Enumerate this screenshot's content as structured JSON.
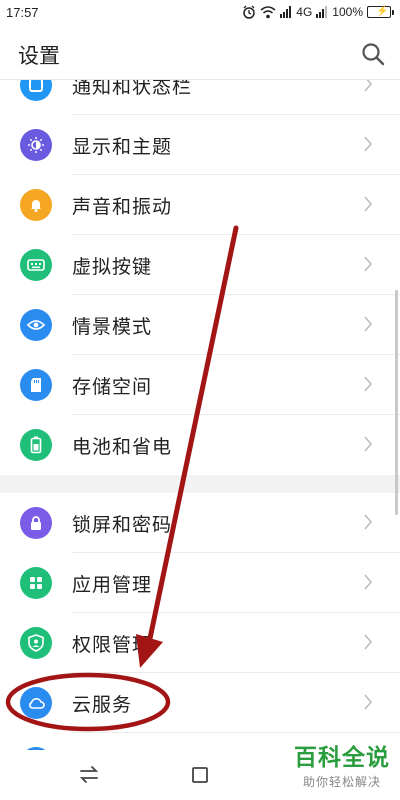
{
  "status_bar": {
    "time": "17:57",
    "network": "4G",
    "battery": "100%"
  },
  "header": {
    "title": "设置",
    "search_icon": "search-icon"
  },
  "settings_items": [
    {
      "label": "通知和状态栏",
      "icon": "notification-icon",
      "color": "#2196f3"
    },
    {
      "label": "显示和主题",
      "icon": "display-icon",
      "color": "#6a5ae0"
    },
    {
      "label": "声音和振动",
      "icon": "bell-icon",
      "color": "#f5a623"
    },
    {
      "label": "虚拟按键",
      "icon": "keyboard-icon",
      "color": "#1fbf7a"
    },
    {
      "label": "情景模式",
      "icon": "eye-icon",
      "color": "#2b8cf0"
    },
    {
      "label": "存储空间",
      "icon": "sdcard-icon",
      "color": "#2b8cf0"
    },
    {
      "label": "电池和省电",
      "icon": "battery-icon",
      "color": "#1fbf7a"
    },
    {
      "label": "锁屏和密码",
      "icon": "lock-icon",
      "color": "#7b5ce6"
    },
    {
      "label": "应用管理",
      "icon": "apps-icon",
      "color": "#1fbf7a"
    },
    {
      "label": "权限管理",
      "icon": "shield-icon",
      "color": "#1fbf7a"
    },
    {
      "label": "云服务",
      "icon": "cloud-icon",
      "color": "#2b8cf0"
    }
  ],
  "nav_bar": {
    "back_icon": "swap-icon",
    "recent_icon": "square-icon"
  },
  "annotation": {
    "color": "#a31515"
  },
  "watermark": {
    "title": "百科全说",
    "subtitle": "助你轻松解决"
  }
}
